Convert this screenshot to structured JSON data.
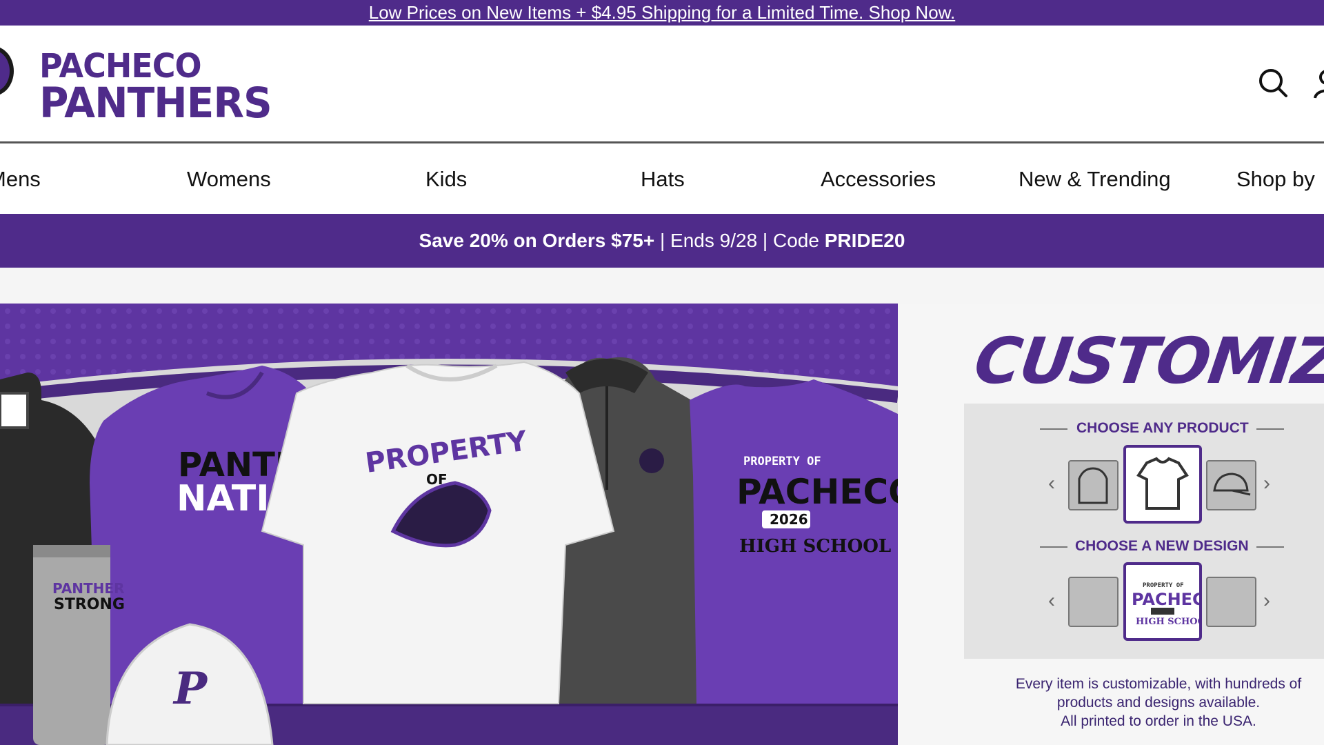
{
  "announcement": {
    "text": "Low Prices on New Items + $4.95 Shipping for a Limited Time. Shop Now."
  },
  "header": {
    "logo_line1": "PACHECO",
    "logo_line2": "PANTHERS",
    "icons": [
      "search-icon",
      "account-icon"
    ]
  },
  "nav": {
    "items": [
      {
        "label": "Mens"
      },
      {
        "label": "Womens"
      },
      {
        "label": "Kids"
      },
      {
        "label": "Hats"
      },
      {
        "label": "Accessories"
      },
      {
        "label": "New & Trending"
      },
      {
        "label": "Shop by"
      }
    ]
  },
  "promo": {
    "part1": "Save 20% on Orders $75+",
    "sep1": " | ",
    "part2": "Ends 9/28",
    "sep2": " | ",
    "part3": "Code ",
    "code": "PRIDE20"
  },
  "hero": {
    "hoodie_text_line1": "PANTHE",
    "hoodie_text_line2": "NATIO",
    "tee_text_top": "PROPERTY",
    "tee_text_of": "OF",
    "tumbler_text1": "PANTHER",
    "tumbler_text2": "STRONG",
    "purple_tee_top": "PROPERTY OF",
    "purple_tee_mid": "PACHECO",
    "purple_tee_year": "2026",
    "purple_tee_bottom": "HIGH SCHOOL",
    "cap_letter": "P"
  },
  "customize": {
    "title": "CUSTOMIZE IT",
    "step1": "CHOOSE ANY PRODUCT",
    "step2": "CHOOSE A NEW DESIGN",
    "design_center_top": "PROPERTY OF",
    "design_center_mid": "PACHECO",
    "design_center_bottom": "HIGH SCHOOL",
    "caption_line1": "Every item is customizable, with hundreds of",
    "caption_line2": "products and designs available.",
    "caption_line3": "All printed to order in the USA."
  },
  "colors": {
    "brand": "#4f2b8a",
    "hero_bg": "#5e35a1"
  }
}
